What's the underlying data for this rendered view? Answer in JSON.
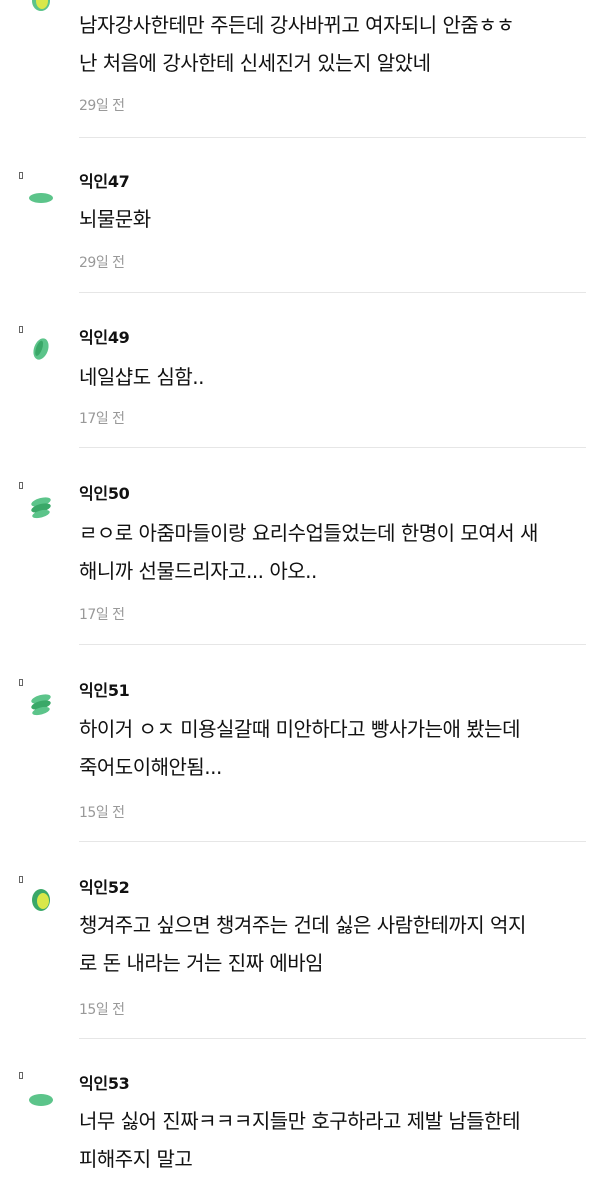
{
  "comments": [
    {
      "author": "",
      "lines": [
        "남자강사한테만 주든데 강사바뀌고 여자되니 안줌ㅎㅎ",
        "난 처음에 강사한테 신세진거 있는지 알았네"
      ],
      "time": "29일 전",
      "avatar": "dot"
    },
    {
      "author": "익인47",
      "lines": [
        "뇌물문화"
      ],
      "time": "29일 전",
      "avatar": "flat"
    },
    {
      "author": "익인49",
      "lines": [
        "네일샵도 심함.."
      ],
      "time": "17일 전",
      "avatar": "leaf"
    },
    {
      "author": "익인50",
      "lines": [
        "ㄹㅇ로 아줌마들이랑 요리수업들었는데 한명이 모여서 새",
        "해니까 선물드리자고... 아오.."
      ],
      "time": "17일 전",
      "avatar": "stack"
    },
    {
      "author": "익인51",
      "lines": [
        "하이거 ㅇㅈ 미용실갈때 미안하다고 빵사가는애 봤는데",
        "죽어도이해안됨..."
      ],
      "time": "15일 전",
      "avatar": "stack"
    },
    {
      "author": "익인52",
      "lines": [
        "챙겨주고 싶으면 챙겨주는 건데 싫은 사람한테까지 억지",
        "로 돈 내라는 거는 진짜 에바임"
      ],
      "time": "15일 전",
      "avatar": "blob"
    },
    {
      "author": "익인53",
      "lines": [
        "너무 싫어 진짜ㅋㅋㅋ지들만 호구하라고 제발 남들한테",
        "피해주지 말고"
      ],
      "time": "",
      "avatar": "flat"
    }
  ],
  "colors": {
    "avatar_green": "#5cc48a",
    "avatar_green_dark": "#3aa868",
    "avatar_yellow": "#d9e84a",
    "text": "#111111",
    "time": "#999999",
    "divider": "#e6e6e6"
  }
}
